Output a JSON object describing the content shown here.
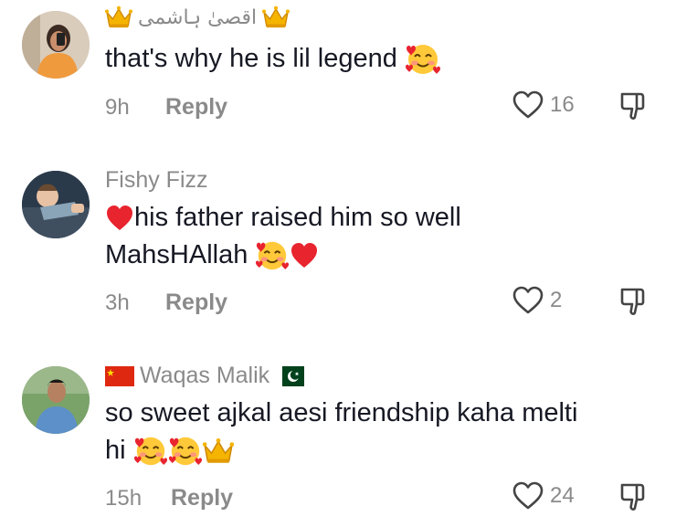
{
  "comments": [
    {
      "username": "اقصیٰ ہاشمی",
      "text": "that's why he is lil legend",
      "text_line2": "",
      "time": "9h",
      "reply_label": "Reply",
      "likes": "16"
    },
    {
      "username": "Fishy Fizz",
      "text": "his father raised him so well",
      "text_line2": "MahsHAllah",
      "time": "3h",
      "reply_label": "Reply",
      "likes": "2"
    },
    {
      "username": "Waqas Malik",
      "text": "so sweet ajkal aesi friendship kaha melti",
      "text_line2": "hi",
      "time": "15h",
      "reply_label": "Reply",
      "likes": "24"
    }
  ],
  "icons": {
    "crown": "crown-icon",
    "heart": "heart-outline-icon",
    "dislike": "thumbs-down-icon",
    "red_heart": "red-heart-emoji",
    "smiling_hearts": "smiling-face-with-hearts-emoji",
    "flag_china": "flag-china-icon",
    "flag_pakistan": "flag-pakistan-icon"
  }
}
